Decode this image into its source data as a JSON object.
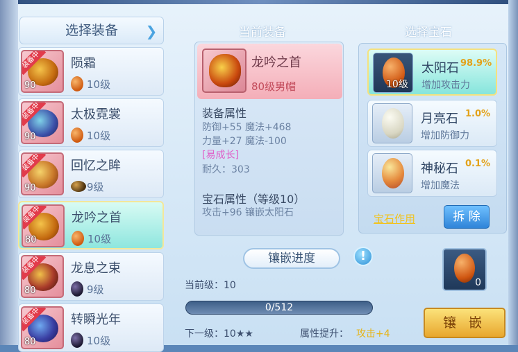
{
  "left_panel": {
    "header": "选择装备",
    "items": [
      {
        "badge": "装备中",
        "level": "90",
        "name": "陨霜",
        "gem_grade": "10级",
        "gem": "orange"
      },
      {
        "badge": "装备中",
        "level": "90",
        "name": "太极霓裳",
        "gem_grade": "10级",
        "gem": "orange"
      },
      {
        "badge": "装备中",
        "level": "90",
        "name": "回忆之眸",
        "gem_grade": "9级",
        "gem": "brown"
      },
      {
        "badge": "装备中",
        "level": "80",
        "name": "龙吟之首",
        "gem_grade": "10级",
        "gem": "orange"
      },
      {
        "badge": "装备中",
        "level": "80",
        "name": "龙息之束",
        "gem_grade": "9级",
        "gem": "dark"
      },
      {
        "badge": "装备中",
        "level": "80",
        "name": "转瞬光年",
        "gem_grade": "10级",
        "gem": "dark"
      }
    ]
  },
  "middle_panel": {
    "title": "当前装备",
    "equip_name": "龙吟之首",
    "equip_sub": "80级男帽",
    "attr_header": "装备属性",
    "attr_line1": "防御+55 魔法+468",
    "attr_line2": "力量+27 魔法-100",
    "growth": "[易成长]",
    "durability": "耐久：303",
    "gem_attr_header": "宝石属性（等级10）",
    "gem_attr_line": "攻击+96 镶嵌太阳石",
    "inlay_progress_label": "镶嵌进度",
    "info_icon": "!",
    "current_level": "当前级：10",
    "progress_text": "0/512",
    "next_level": "下一级：10★★",
    "boost_label": "属性提升：",
    "boost_value": "攻击+4"
  },
  "right_panel": {
    "title": "选择宝石",
    "gems": [
      {
        "name": "太阳石",
        "pct": "98.9%",
        "desc": "增加攻击力",
        "level": "10级"
      },
      {
        "name": "月亮石",
        "pct": "1.0%",
        "desc": "增加防御力"
      },
      {
        "name": "神秘石",
        "pct": "0.1%",
        "desc": "增加魔法"
      }
    ],
    "gem_effect": "宝石作用",
    "remove_button": "拆 除",
    "slot_count": "0",
    "inlay_button": "镶 嵌"
  },
  "colors": {
    "accent_gold": "#e6b418",
    "accent_blue": "#2f84d8",
    "growth_pink": "#e05ec8"
  }
}
